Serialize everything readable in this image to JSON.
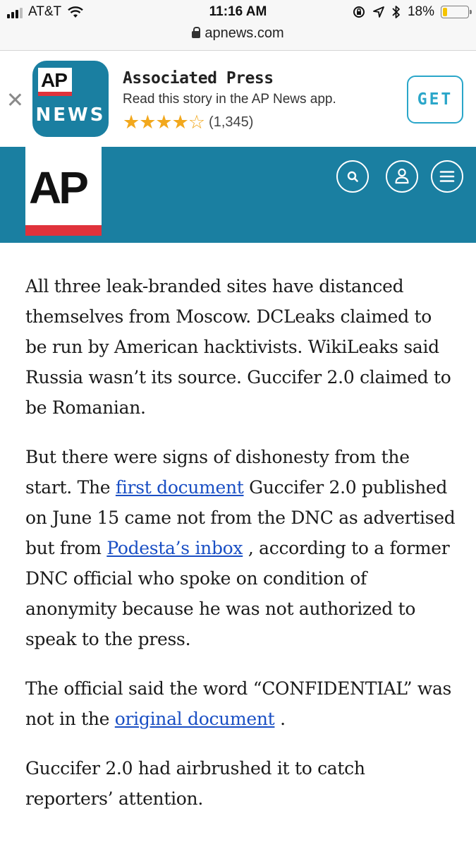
{
  "status_bar": {
    "carrier": "AT&T",
    "time": "11:16 AM",
    "battery_percent_label": "18%",
    "battery_level": 0.18,
    "url": "apnews.com"
  },
  "app_banner": {
    "icon_top": "AP",
    "icon_bottom": "NEWS",
    "app_name": "Associated Press",
    "description": "Read this story in the AP News app.",
    "stars": "★★★★☆",
    "rating": 4.5,
    "rating_count": "(1,345)",
    "get_label": "GET"
  },
  "header": {
    "logo_text": "AP",
    "accent_color": "#1a7fa1",
    "logo_bar_color": "#e0323b",
    "icons": [
      "search-icon",
      "user-icon",
      "menu-icon"
    ]
  },
  "article": {
    "p1": "All three leak-branded sites have distanced themselves from Moscow. DCLeaks claimed to be run by American hacktivists. WikiLeaks said Russia wasn’t its source. Guccifer 2.0 claimed to be Romanian.",
    "p2_before_link1": "But there were signs of dishonesty from the start. The ",
    "p2_link1": "first document",
    "p2_between": " Guccifer 2.0 published on June 15 came not from the DNC as advertised but from ",
    "p2_link2": "Podesta’s inbox",
    "p2_after": " , according to a former DNC official who spoke on condition of anonymity because he was not authorized to speak to the press.",
    "p3_before": "The official said the word “CONFIDENTIAL” was not in the ",
    "p3_link": "original document",
    "p3_after": " .",
    "p4": "Guccifer 2.0 had airbrushed it to catch reporters’ attention."
  }
}
